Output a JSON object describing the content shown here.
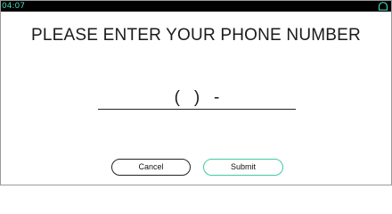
{
  "status_bar": {
    "time": "04:07",
    "home_icon": "home-icon",
    "accent_color": "#41d3b8"
  },
  "prompt": {
    "title": "PLEASE ENTER YOUR PHONE NUMBER"
  },
  "phone_input": {
    "value": "(   )   -"
  },
  "actions": {
    "cancel_label": "Cancel",
    "submit_label": "Submit",
    "submit_border_color": "#41c9a6"
  }
}
